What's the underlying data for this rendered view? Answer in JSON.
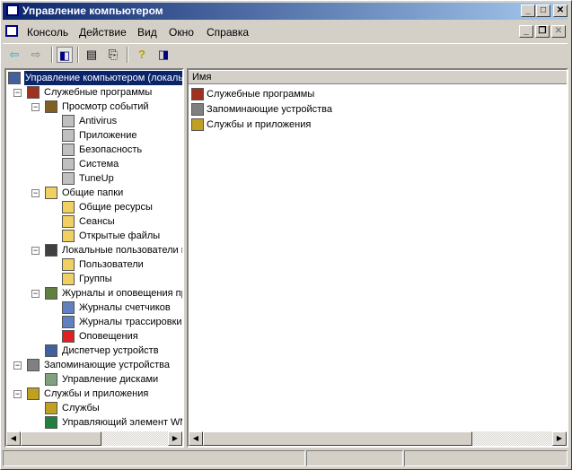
{
  "window": {
    "title": "Управление компьютером"
  },
  "menu": [
    "Консоль",
    "Действие",
    "Вид",
    "Окно",
    "Справка"
  ],
  "toolbar": [
    "back",
    "forward",
    "show-hide-tree",
    "properties",
    "export-list",
    "help",
    "show-hide-action-pane"
  ],
  "tree": [
    {
      "label": "Управление компьютером (локальным)",
      "level": 0,
      "icon": "computer-icon",
      "selected": true
    },
    {
      "label": "Служебные программы",
      "level": 1,
      "exp": "-",
      "icon": "tools-icon"
    },
    {
      "label": "Просмотр событий",
      "level": 2,
      "exp": "-",
      "icon": "event-viewer-icon"
    },
    {
      "label": "Antivirus",
      "level": 3,
      "icon": "log-icon"
    },
    {
      "label": "Приложение",
      "level": 3,
      "icon": "log-icon"
    },
    {
      "label": "Безопасность",
      "level": 3,
      "icon": "log-icon"
    },
    {
      "label": "Система",
      "level": 3,
      "icon": "log-icon"
    },
    {
      "label": "TuneUp",
      "level": 3,
      "icon": "log-icon"
    },
    {
      "label": "Общие папки",
      "level": 2,
      "exp": "-",
      "icon": "folder-icon"
    },
    {
      "label": "Общие ресурсы",
      "level": 3,
      "icon": "folder-icon"
    },
    {
      "label": "Сеансы",
      "level": 3,
      "icon": "folder-icon"
    },
    {
      "label": "Открытые файлы",
      "level": 3,
      "icon": "folder-icon"
    },
    {
      "label": "Локальные пользователи и группы",
      "level": 2,
      "exp": "-",
      "icon": "users-icon"
    },
    {
      "label": "Пользователи",
      "level": 3,
      "icon": "folder-icon"
    },
    {
      "label": "Группы",
      "level": 3,
      "icon": "folder-icon"
    },
    {
      "label": "Журналы и оповещения производительности",
      "level": 2,
      "exp": "-",
      "icon": "perf-logs-icon"
    },
    {
      "label": "Журналы счетчиков",
      "level": 3,
      "icon": "chart-icon"
    },
    {
      "label": "Журналы трассировки",
      "level": 3,
      "icon": "chart-icon"
    },
    {
      "label": "Оповещения",
      "level": 3,
      "icon": "alert-icon"
    },
    {
      "label": "Диспетчер устройств",
      "level": 2,
      "icon": "device-manager-icon"
    },
    {
      "label": "Запоминающие устройства",
      "level": 1,
      "exp": "-",
      "icon": "storage-icon"
    },
    {
      "label": "Управление дисками",
      "level": 2,
      "icon": "disk-icon"
    },
    {
      "label": "Службы и приложения",
      "level": 1,
      "exp": "-",
      "icon": "services-icon"
    },
    {
      "label": "Службы",
      "level": 2,
      "icon": "gear-icon"
    },
    {
      "label": "Управляющий элемент WMI",
      "level": 2,
      "icon": "wmi-icon"
    }
  ],
  "list": {
    "column": "Имя",
    "items": [
      {
        "label": "Служебные программы",
        "icon": "tools-icon"
      },
      {
        "label": "Запоминающие устройства",
        "icon": "storage-icon"
      },
      {
        "label": "Службы и приложения",
        "icon": "services-icon"
      }
    ]
  }
}
